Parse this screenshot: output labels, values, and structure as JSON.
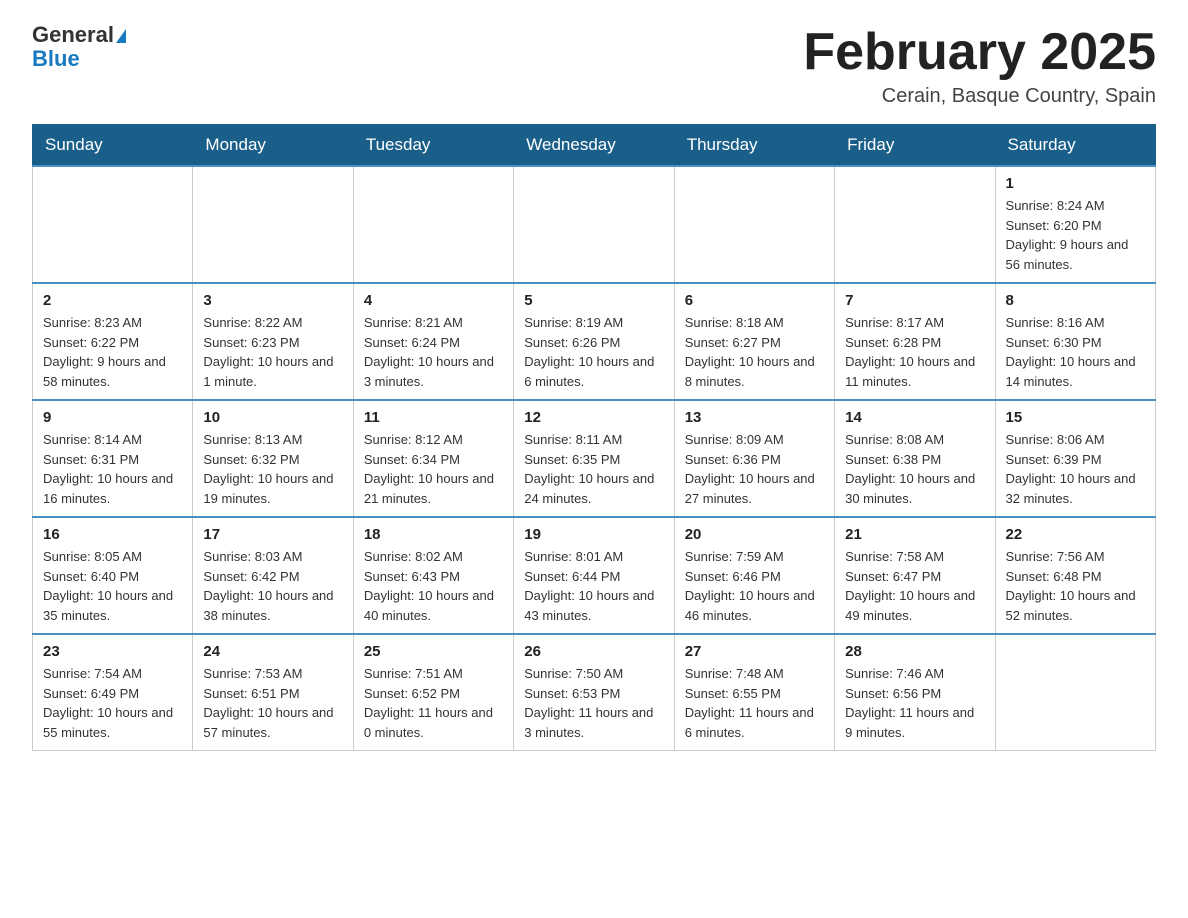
{
  "header": {
    "logo_general": "General",
    "logo_blue": "Blue",
    "month_title": "February 2025",
    "location": "Cerain, Basque Country, Spain"
  },
  "weekdays": [
    "Sunday",
    "Monday",
    "Tuesday",
    "Wednesday",
    "Thursday",
    "Friday",
    "Saturday"
  ],
  "weeks": [
    [
      {
        "day": "",
        "info": ""
      },
      {
        "day": "",
        "info": ""
      },
      {
        "day": "",
        "info": ""
      },
      {
        "day": "",
        "info": ""
      },
      {
        "day": "",
        "info": ""
      },
      {
        "day": "",
        "info": ""
      },
      {
        "day": "1",
        "info": "Sunrise: 8:24 AM\nSunset: 6:20 PM\nDaylight: 9 hours and 56 minutes."
      }
    ],
    [
      {
        "day": "2",
        "info": "Sunrise: 8:23 AM\nSunset: 6:22 PM\nDaylight: 9 hours and 58 minutes."
      },
      {
        "day": "3",
        "info": "Sunrise: 8:22 AM\nSunset: 6:23 PM\nDaylight: 10 hours and 1 minute."
      },
      {
        "day": "4",
        "info": "Sunrise: 8:21 AM\nSunset: 6:24 PM\nDaylight: 10 hours and 3 minutes."
      },
      {
        "day": "5",
        "info": "Sunrise: 8:19 AM\nSunset: 6:26 PM\nDaylight: 10 hours and 6 minutes."
      },
      {
        "day": "6",
        "info": "Sunrise: 8:18 AM\nSunset: 6:27 PM\nDaylight: 10 hours and 8 minutes."
      },
      {
        "day": "7",
        "info": "Sunrise: 8:17 AM\nSunset: 6:28 PM\nDaylight: 10 hours and 11 minutes."
      },
      {
        "day": "8",
        "info": "Sunrise: 8:16 AM\nSunset: 6:30 PM\nDaylight: 10 hours and 14 minutes."
      }
    ],
    [
      {
        "day": "9",
        "info": "Sunrise: 8:14 AM\nSunset: 6:31 PM\nDaylight: 10 hours and 16 minutes."
      },
      {
        "day": "10",
        "info": "Sunrise: 8:13 AM\nSunset: 6:32 PM\nDaylight: 10 hours and 19 minutes."
      },
      {
        "day": "11",
        "info": "Sunrise: 8:12 AM\nSunset: 6:34 PM\nDaylight: 10 hours and 21 minutes."
      },
      {
        "day": "12",
        "info": "Sunrise: 8:11 AM\nSunset: 6:35 PM\nDaylight: 10 hours and 24 minutes."
      },
      {
        "day": "13",
        "info": "Sunrise: 8:09 AM\nSunset: 6:36 PM\nDaylight: 10 hours and 27 minutes."
      },
      {
        "day": "14",
        "info": "Sunrise: 8:08 AM\nSunset: 6:38 PM\nDaylight: 10 hours and 30 minutes."
      },
      {
        "day": "15",
        "info": "Sunrise: 8:06 AM\nSunset: 6:39 PM\nDaylight: 10 hours and 32 minutes."
      }
    ],
    [
      {
        "day": "16",
        "info": "Sunrise: 8:05 AM\nSunset: 6:40 PM\nDaylight: 10 hours and 35 minutes."
      },
      {
        "day": "17",
        "info": "Sunrise: 8:03 AM\nSunset: 6:42 PM\nDaylight: 10 hours and 38 minutes."
      },
      {
        "day": "18",
        "info": "Sunrise: 8:02 AM\nSunset: 6:43 PM\nDaylight: 10 hours and 40 minutes."
      },
      {
        "day": "19",
        "info": "Sunrise: 8:01 AM\nSunset: 6:44 PM\nDaylight: 10 hours and 43 minutes."
      },
      {
        "day": "20",
        "info": "Sunrise: 7:59 AM\nSunset: 6:46 PM\nDaylight: 10 hours and 46 minutes."
      },
      {
        "day": "21",
        "info": "Sunrise: 7:58 AM\nSunset: 6:47 PM\nDaylight: 10 hours and 49 minutes."
      },
      {
        "day": "22",
        "info": "Sunrise: 7:56 AM\nSunset: 6:48 PM\nDaylight: 10 hours and 52 minutes."
      }
    ],
    [
      {
        "day": "23",
        "info": "Sunrise: 7:54 AM\nSunset: 6:49 PM\nDaylight: 10 hours and 55 minutes."
      },
      {
        "day": "24",
        "info": "Sunrise: 7:53 AM\nSunset: 6:51 PM\nDaylight: 10 hours and 57 minutes."
      },
      {
        "day": "25",
        "info": "Sunrise: 7:51 AM\nSunset: 6:52 PM\nDaylight: 11 hours and 0 minutes."
      },
      {
        "day": "26",
        "info": "Sunrise: 7:50 AM\nSunset: 6:53 PM\nDaylight: 11 hours and 3 minutes."
      },
      {
        "day": "27",
        "info": "Sunrise: 7:48 AM\nSunset: 6:55 PM\nDaylight: 11 hours and 6 minutes."
      },
      {
        "day": "28",
        "info": "Sunrise: 7:46 AM\nSunset: 6:56 PM\nDaylight: 11 hours and 9 minutes."
      },
      {
        "day": "",
        "info": ""
      }
    ]
  ]
}
